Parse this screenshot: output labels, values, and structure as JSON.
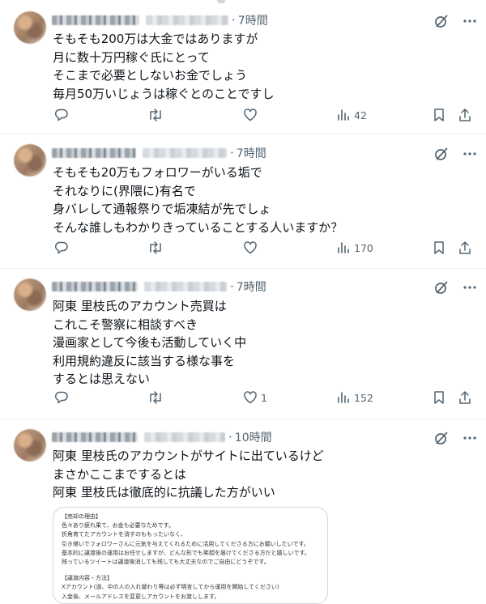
{
  "tweets": [
    {
      "time": "7時間",
      "text": "そもそも200万は大金ではありますが\n月に数十万円稼ぐ氏にとって\nそこまで必要としないお金でしょう\n毎月50万いじょうは稼ぐとのことですし",
      "likes": "",
      "views": "42"
    },
    {
      "time": "7時間",
      "text": "そもそも20万もフォロワーがいる垢で\nそれなりに(界隈に)有名で\n身バレして通報祭りで垢凍結が先でしょ\nそんな誰しもわかりきっていることする人いますか？",
      "likes": "",
      "views": "170"
    },
    {
      "time": "7時間",
      "text": "阿東 里枝氏のアカウント売買は\nこれこそ警察に相談すべき\n漫画家として今後も活動していく中\n利用規約違反に該当する様な事を\nするとは思えない",
      "likes": "1",
      "views": "152"
    },
    {
      "time": "10時間",
      "text": "阿東 里枝氏のアカウントがサイトに出ているけど\nまさかここまでするとは\n阿東 里枝氏は徹底的に抗議した方がいい",
      "likes": "",
      "views": ""
    }
  ],
  "card": {
    "lines": [
      "【売却の理由】",
      "色々あり疲れ果て、お金も必要なためです。",
      "折角育てたアカウントを消すのももったいなく、",
      "引き継いでフォロワーさんに元気を与えてくれるために活用してくださる方にお願いしたいです。",
      "基本的に譲渡後の運用はお任せしますが、どんな形でも笑顔を届けてくださる方だと嬉しいです。",
      "残っているツイートは譲渡後消しても残しても大丈夫なのでご自由にどうぞです。",
      "",
      "【譲渡内容・方法】",
      "Xアカウント(過、中の人の入れ替わり等は必ず明言してから運用を開始してください)",
      "入金後、メールアドレスを変更しアカウントをお渡しします。"
    ]
  },
  "icons": {
    "grok": "grok-icon",
    "more": "more-icon",
    "reply": "reply-icon",
    "retweet": "retweet-icon",
    "like": "like-icon",
    "views": "views-icon",
    "bookmark": "bookmark-icon",
    "share": "share-icon"
  },
  "colors": {
    "text": "#0f1419",
    "secondary": "#536471",
    "border": "#eff3f4"
  }
}
